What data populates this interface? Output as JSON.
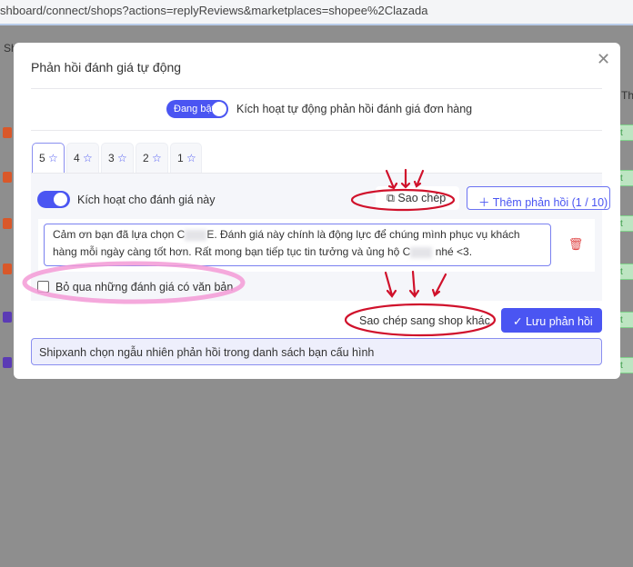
{
  "browser": {
    "url": "shboard/connect/shops?actions=replyReviews&marketplaces=shopee%2Clazada"
  },
  "background": {
    "left_text": "Sh",
    "right_text": "Th",
    "badge_text": "t nơ"
  },
  "modal": {
    "title": "Phản hồi đánh giá tự động",
    "close_icon": "close-icon",
    "master_toggle": {
      "label": "Đang bật",
      "on": true,
      "description": "Kích hoạt tự động phản hồi đánh giá đơn hàng"
    },
    "tabs": [
      {
        "label": "5",
        "active": true
      },
      {
        "label": "4"
      },
      {
        "label": "3"
      },
      {
        "label": "2"
      },
      {
        "label": "1"
      }
    ],
    "rating_toggle": {
      "label": "Kích hoạt cho đánh giá này",
      "on": true
    },
    "copy_button": "Sao chép",
    "add_reply_button": "Thêm phản hồi (1 / 10)",
    "reply_text_1": "Cảm ơn bạn đã lựa chọn C",
    "reply_text_2": "E. Đánh giá này chính là động lực để chúng mình phục vụ khách hàng mỗi ngày càng tốt hơn. Rất mong bạn tiếp tục tin tưởng và ủng hộ C",
    "reply_text_3": " nhé <3.",
    "skip_checkbox": {
      "label": "Bỏ qua những đánh giá có văn bản",
      "checked": false
    },
    "copy_to_shop_button": "Sao chép sang shop khác",
    "save_button": "Lưu phản hồi",
    "info": "Shipxanh chọn ngẫu nhiên phản hồi trong danh sách bạn cấu hình"
  },
  "colors": {
    "accent": "#4a55f2",
    "annotation_red": "#d0112b",
    "annotation_pink": "#f39ad6"
  }
}
